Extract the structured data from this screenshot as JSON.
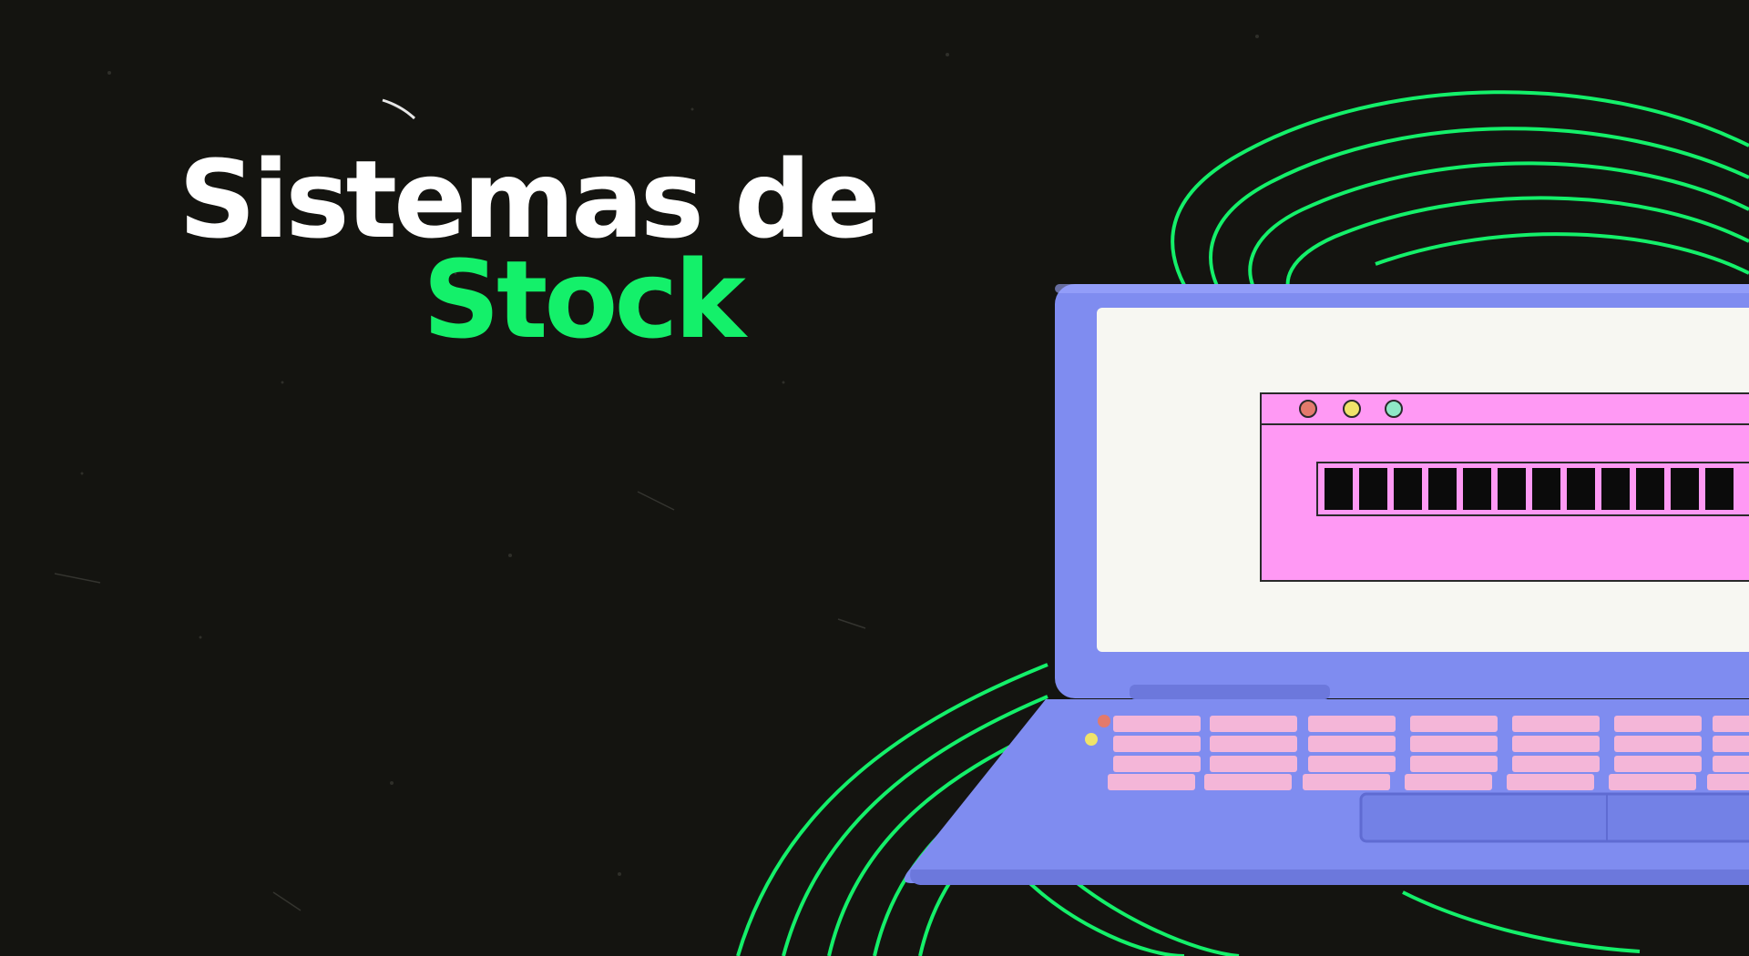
{
  "banner": {
    "title_line1": "Sistemas de",
    "title_line2": "Stock"
  },
  "illustration": {
    "icon": "laptop-icon",
    "window_dots": [
      "#e37a6c",
      "#f0e36a",
      "#8fe8c7"
    ],
    "progress_segments": 12,
    "progress_value": 1.0
  },
  "colors": {
    "background": "#141410",
    "accent": "#14f06a",
    "laptop_body": "#7f8cf0",
    "screen_window": "#ff99f4",
    "keys": "#f4b6d8"
  }
}
